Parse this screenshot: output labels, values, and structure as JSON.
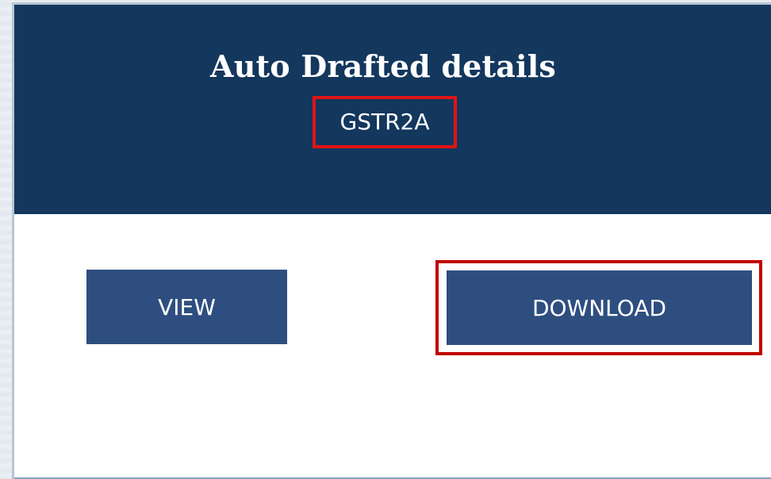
{
  "tile": {
    "title": "Auto Drafted details",
    "subtitle": "GSTR2A"
  },
  "actions": {
    "view_label": "VIEW",
    "download_label": "DOWNLOAD"
  },
  "colors": {
    "header_bg": "#13375d",
    "button_bg": "#2e4e80",
    "highlight_border": "#e01414"
  }
}
